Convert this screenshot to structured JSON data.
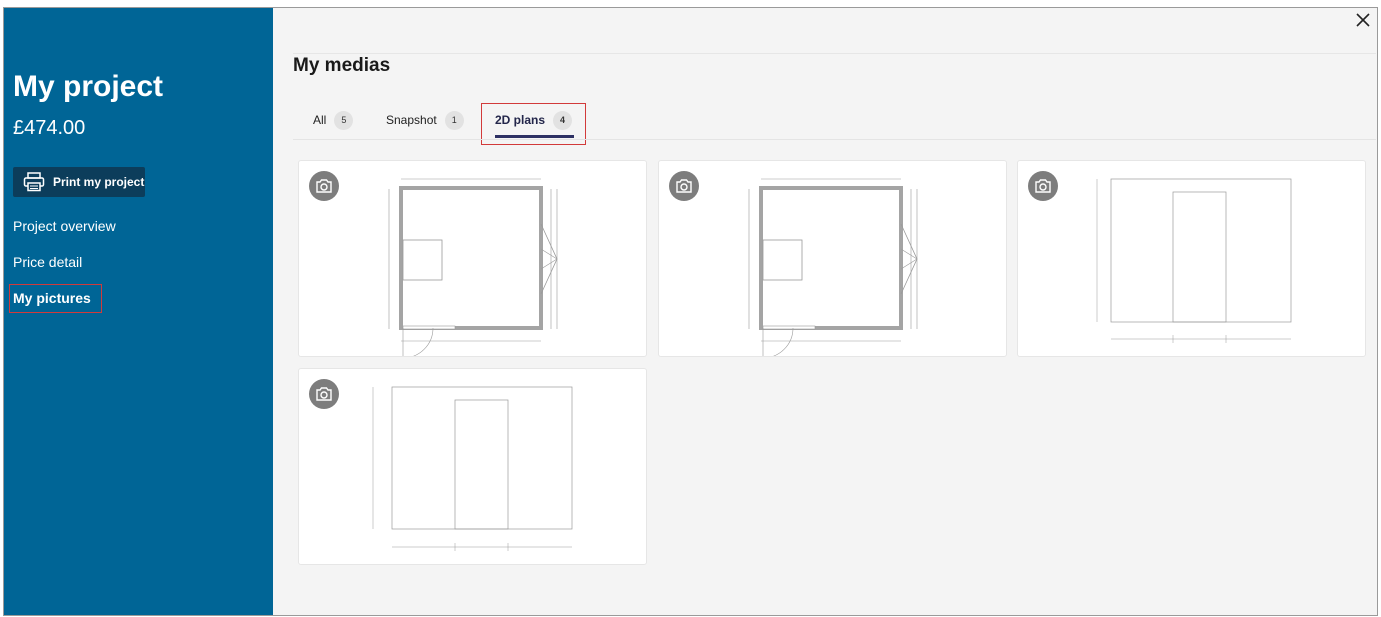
{
  "sidebar": {
    "title": "My project",
    "price": "£474.00",
    "print_label": "Print my project",
    "nav": [
      {
        "label": "Project overview"
      },
      {
        "label": "Price detail"
      },
      {
        "label": "My pictures"
      }
    ]
  },
  "main": {
    "title": "My medias",
    "tabs": [
      {
        "label": "All",
        "count": "5"
      },
      {
        "label": "Snapshot",
        "count": "1"
      },
      {
        "label": "2D plans",
        "count": "4"
      }
    ],
    "active_tab": "2D plans"
  },
  "icons": {
    "close": "close-icon",
    "print": "printer-icon",
    "camera": "camera-icon"
  },
  "colors": {
    "sidebar_bg": "#006596",
    "print_button_bg": "#0c3d5b",
    "tab_underline": "#2d3063",
    "highlight_border": "#d23a3a"
  }
}
